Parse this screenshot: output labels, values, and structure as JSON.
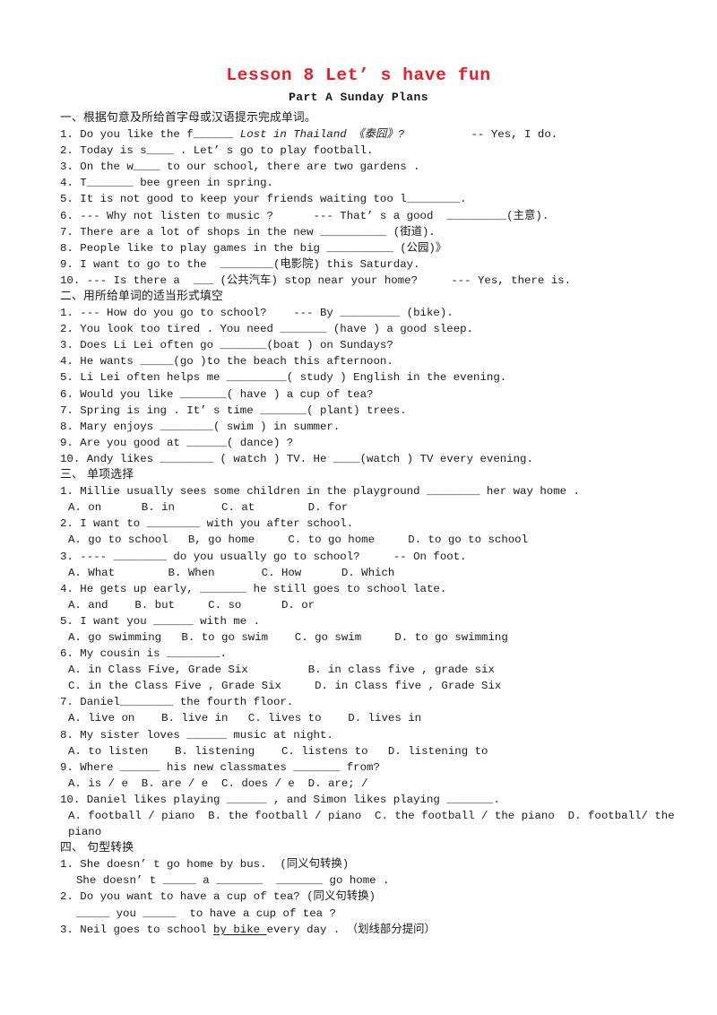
{
  "title": "Lesson 8  Let’ s have fun",
  "subtitle": "Part  A   Sunday Plans",
  "sections": {
    "one": {
      "heading": "一、根据句意及所给首字母或汉语提示完成单词。",
      "q1_a": "1. Do you like the f______ ",
      "q1_italic": "Lost in Thailand 《泰囧》?",
      "q1_b": "          -- Yes, I do.",
      "q2": "2. Today is s____ . Let’ s go to play football.",
      "q3": "3. On the w____ to our school, there are two gardens .",
      "q4": "4. T_______ bee green in spring.",
      "q5": "5. It is not good to keep your friends waiting too l________.",
      "q6": "6. --- Why not listen to music ?      --- That’ s a good  _________(主意).",
      "q7": "7. There are a lot of shops in the new __________ (街道).",
      "q8": "8. People like to play games in the big __________ (公园)》",
      "q9": "9. I want to go to the  ________(电影院) this Saturday.",
      "q10": "10. --- Is there a  ___ (公共汽车) stop near your home?     --- Yes, there is."
    },
    "two": {
      "heading": "二、用所给单词的适当形式填空",
      "q1": "1. --- How do you go to school?    --- By _________ (bike).",
      "q2": "2. You look too tired . You need _______ (have ) a good sleep.",
      "q3": "3. Does Li Lei often go _______(boat ) on Sundays?",
      "q4": "4. He wants _____(go )to the beach this afternoon.",
      "q5": "5. Li Lei often helps me _________( study ) English in the evening.",
      "q6": "6. Would you like _______( have ) a cup of tea?",
      "q7": "7. Spring is ing . It’ s time _______( plant) trees.",
      "q8": "8. Mary enjoys ________( swim ) in summer.",
      "q9": "9. Are you good at ______( dance) ?",
      "q10": "10. Andy likes ________ ( watch ) TV. He ____(watch ) TV every evening."
    },
    "three": {
      "heading": "三、 单项选择",
      "q1": "1. Millie usually sees some children in the playground ________ her way home .",
      "q1_opts": "A. on      B. in       C. at        D. for",
      "q2": "2. I want to ________ with you after school.",
      "q2_opts": "A. go to school   B, go home     C. to go home     D. to go to school",
      "q3": "3. ---- ________ do you usually go to school?     -- On foot.",
      "q3_opts": "A. What        B. When       C. How      D. Which",
      "q4": "4. He gets up early, _______ he still goes to school late.",
      "q4_opts": "A. and    B. but     C. so      D. or",
      "q5": "5. I want you ______ with me .",
      "q5_opts": "A. go swimming   B. to go swim    C. go swim     D. to go swimming",
      "q6": "6. My cousin is ________.",
      "q6_opts_a": "A. in Class Five, Grade Six         B. in class five , grade six",
      "q6_opts_b": "C. in the Class Five , Grade Six     D. in Class five , Grade Six",
      "q7": "7. Daniel________ the fourth floor.",
      "q7_opts": "A. live on    B. live in   C. lives to    D. lives in",
      "q8": "8. My sister loves ______ music at night.",
      "q8_opts": "A. to listen    B. listening    C. listens to   D. listening to",
      "q9": "9. Where ______ his new classmates _______ from?",
      "q9_opts": "A. is / e  B. are / e  C. does / e  D. are; /",
      "q10": "10. Daniel likes playing ______ , and Simon likes playing _______.",
      "q10_opts": "A. football / piano  B. the football / piano  C. the football / the piano  D. football/ the piano"
    },
    "four": {
      "heading": "四、 句型转换",
      "q1": "1. She doesn’ t go home by bus.  (同义句转换)",
      "q1_sub": "She doesn’ t _____ a _______  _______ go home .",
      "q2": "2. Do you want to have a cup of tea? (同义句转换)",
      "q2_sub": "_____ you _____  to have a cup of tea ?",
      "q3_a": "3. Neil goes to school ",
      "q3_underline": "by bike ",
      "q3_b": "every day . （划线部分提问）"
    }
  }
}
